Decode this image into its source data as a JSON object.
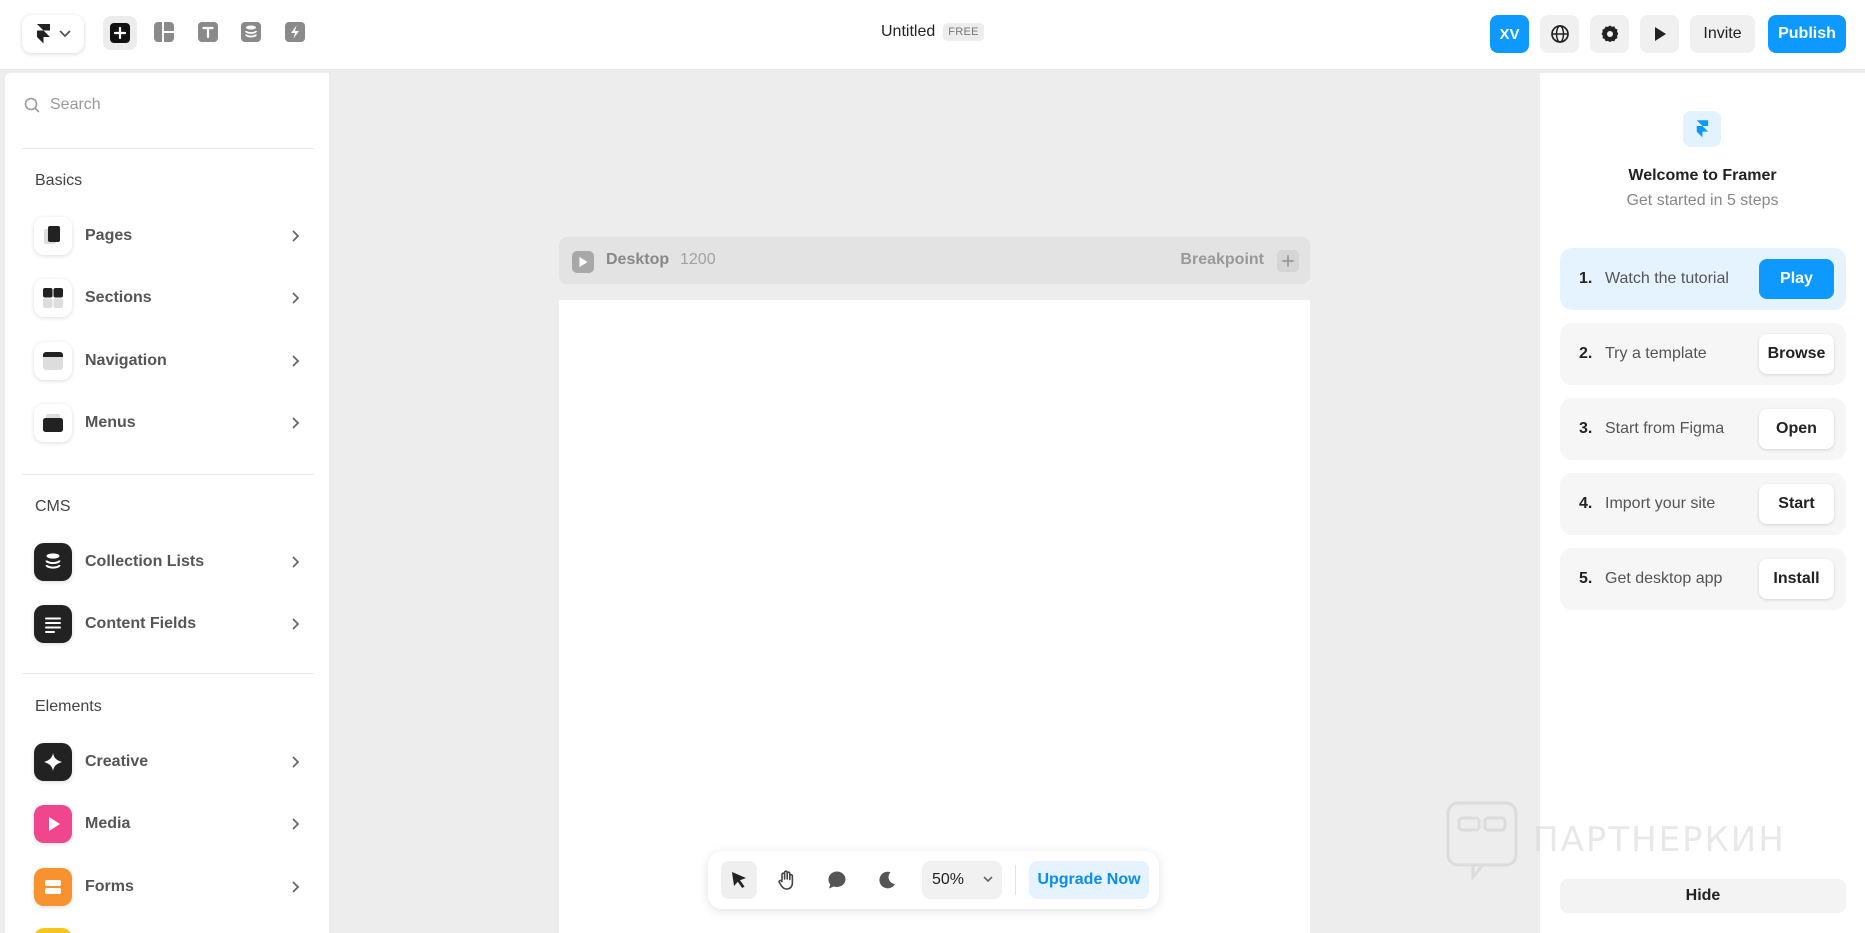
{
  "app": {
    "doc_title": "Untitled",
    "plan_badge": "FREE",
    "avatar_initials": "XV",
    "invite_label": "Invite",
    "publish_label": "Publish",
    "accent_color": "#0d99ff"
  },
  "toolbar": {
    "tools": [
      "insert-icon",
      "layout-icon",
      "text-icon",
      "cms-icon",
      "plugins-icon"
    ]
  },
  "sidebar": {
    "search_placeholder": "Search",
    "sections": [
      {
        "title": "Basics",
        "items": [
          {
            "label": "Pages",
            "icon": "pages-icon"
          },
          {
            "label": "Sections",
            "icon": "sections-icon"
          },
          {
            "label": "Navigation",
            "icon": "navigation-icon"
          },
          {
            "label": "Menus",
            "icon": "menus-icon"
          }
        ]
      },
      {
        "title": "CMS",
        "items": [
          {
            "label": "Collection Lists",
            "icon": "database-icon"
          },
          {
            "label": "Content Fields",
            "icon": "text-lines-icon"
          }
        ]
      },
      {
        "title": "Elements",
        "items": [
          {
            "label": "Creative",
            "icon": "sparkle-icon"
          },
          {
            "label": "Media",
            "icon": "play-icon"
          },
          {
            "label": "Forms",
            "icon": "form-icon"
          }
        ]
      }
    ]
  },
  "canvas": {
    "frame_name": "Desktop",
    "frame_width": "1200",
    "breakpoint_label": "Breakpoint",
    "zoom": "50%",
    "upgrade_label": "Upgrade Now"
  },
  "welcome": {
    "title": "Welcome to Framer",
    "subtitle": "Get started in 5 steps",
    "steps": [
      {
        "num": "1.",
        "text": "Watch the tutorial",
        "button": "Play"
      },
      {
        "num": "2.",
        "text": "Try a template",
        "button": "Browse"
      },
      {
        "num": "3.",
        "text": "Start from Figma",
        "button": "Open"
      },
      {
        "num": "4.",
        "text": "Import your site",
        "button": "Start"
      },
      {
        "num": "5.",
        "text": "Get desktop app",
        "button": "Install"
      }
    ],
    "hide_label": "Hide"
  },
  "watermark": {
    "text": "ПАРТНЕРКИН"
  }
}
